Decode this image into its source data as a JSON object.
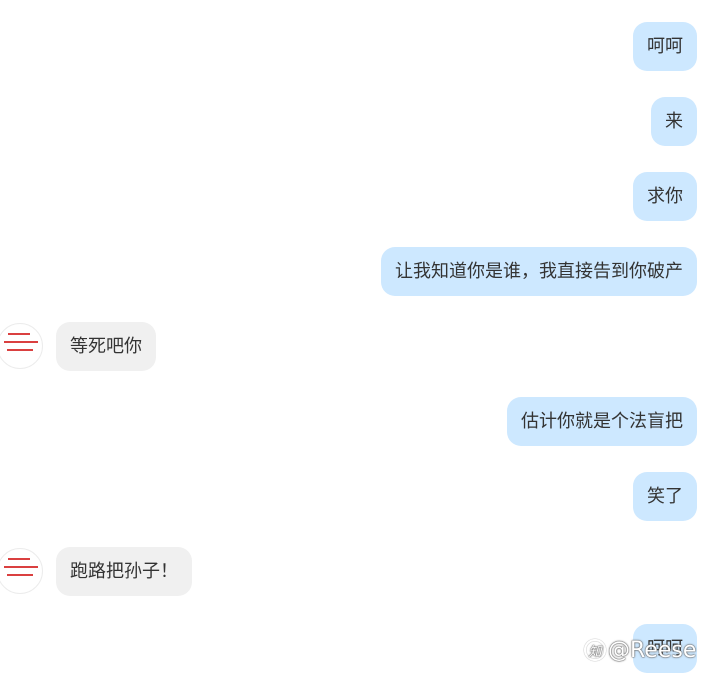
{
  "messages": [
    {
      "side": "me",
      "text": "呵呵"
    },
    {
      "side": "me",
      "text": "来"
    },
    {
      "side": "me",
      "text": "求你"
    },
    {
      "side": "me",
      "text": "让我知道你是谁，我直接告到你破产"
    },
    {
      "side": "them",
      "text": "等死吧你"
    },
    {
      "side": "me",
      "text": "估计你就是个法盲把"
    },
    {
      "side": "me",
      "text": "笑了"
    },
    {
      "side": "them",
      "text": "跑路把孙子！"
    },
    {
      "side": "me",
      "text": "呵呵"
    }
  ],
  "watermark": {
    "logo_glyph": "知",
    "text": "@Reese"
  },
  "colors": {
    "my_bubble": "#cde8ff",
    "their_bubble": "#f0f0f0",
    "avatar_mark": "#d41e1e"
  }
}
